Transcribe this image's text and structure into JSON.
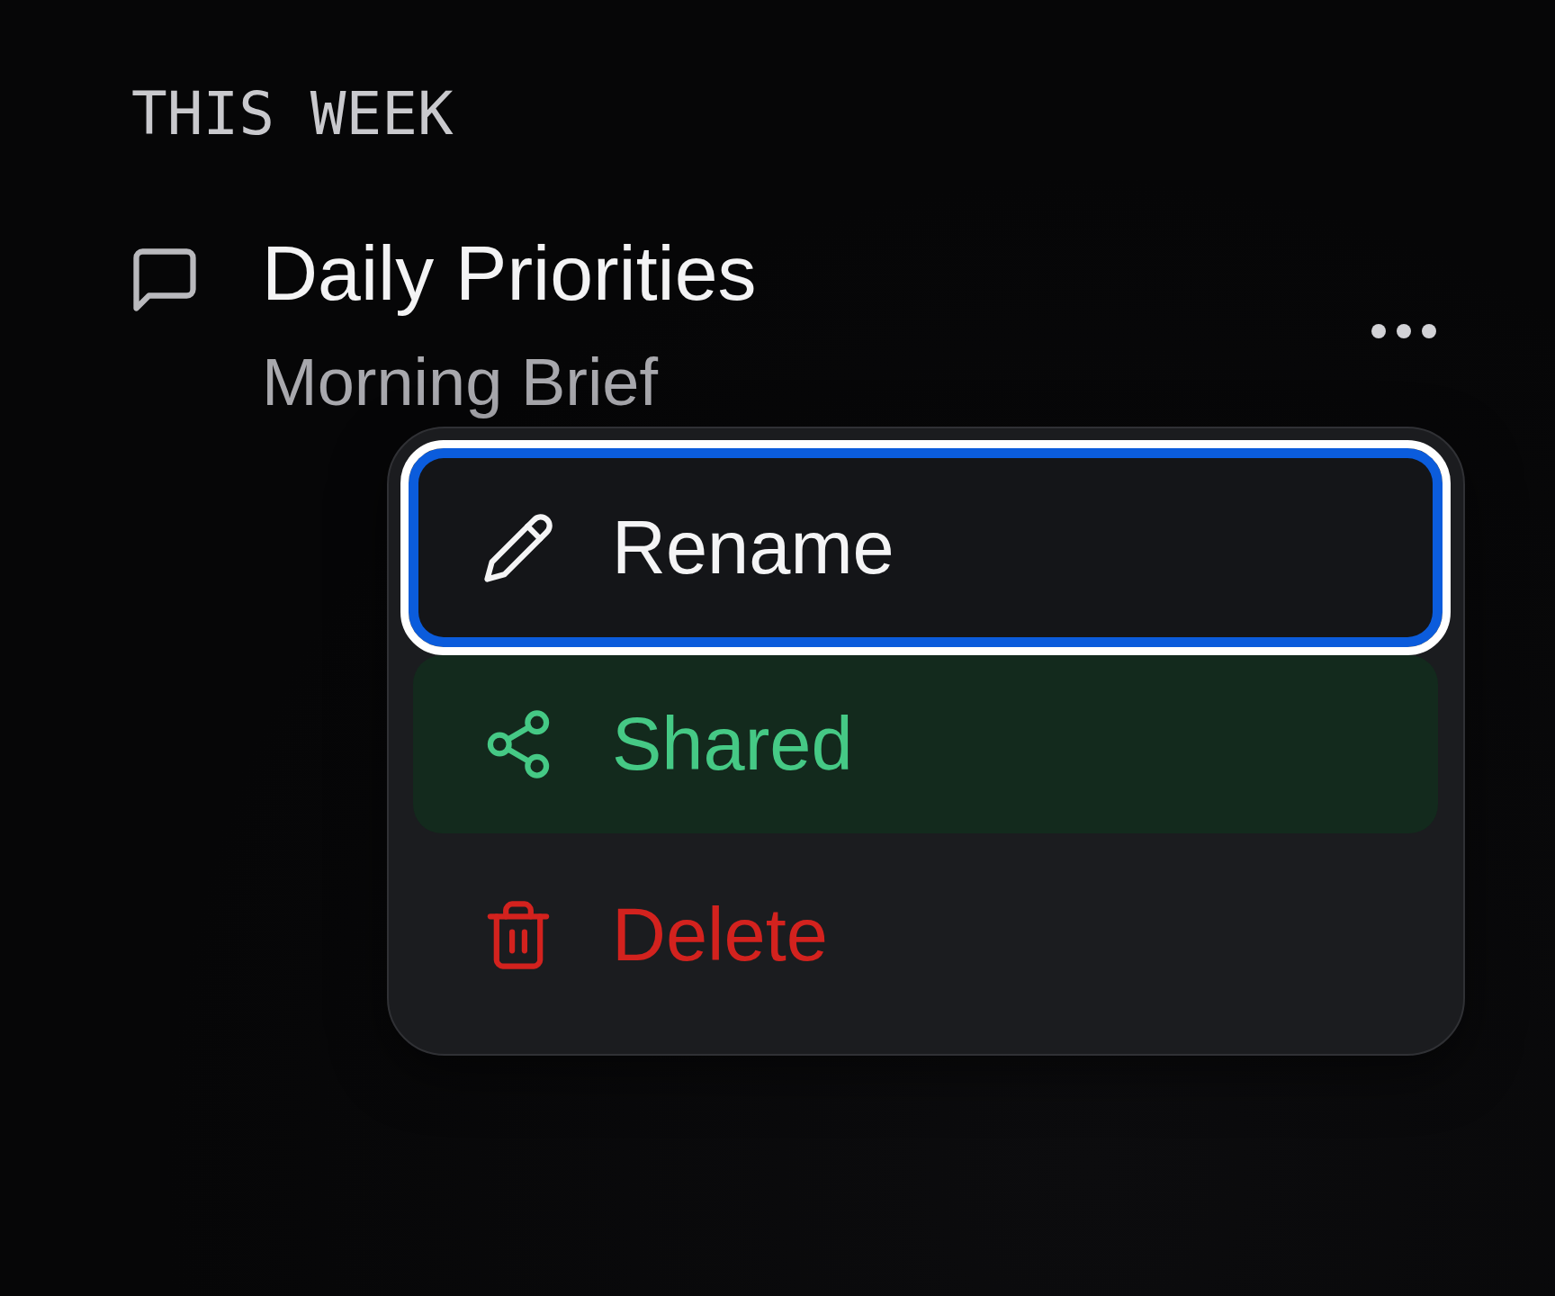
{
  "section": {
    "title": "THIS WEEK"
  },
  "conversation": {
    "title": "Daily Priorities",
    "subtitle": "Morning Brief"
  },
  "menu": {
    "items": [
      {
        "kind": "action",
        "label": "Rename",
        "selected": true,
        "on": false
      },
      {
        "kind": "action",
        "label": "Shared",
        "selected": false,
        "on": true
      },
      {
        "kind": "danger",
        "label": "Delete",
        "selected": false,
        "on": false
      }
    ]
  }
}
